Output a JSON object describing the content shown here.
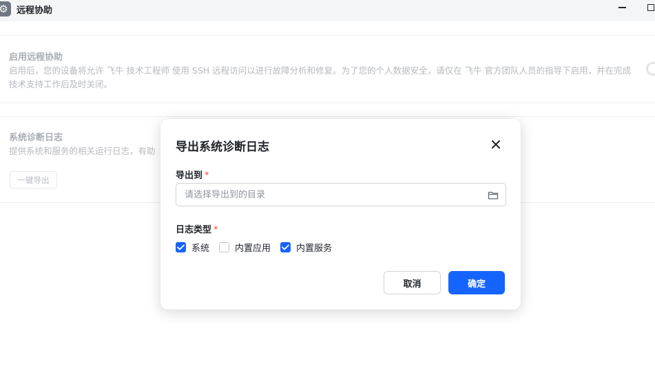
{
  "window": {
    "title": "远程协助",
    "icon": "gear-icon"
  },
  "settings": {
    "remote_assist": {
      "title": "启用远程协助",
      "description": "启用后，您的设备将允许 飞牛 技术工程师 使用 SSH 远程访问以进行故障分析和修复。为了您的个人数据安全，请仅在 飞牛 官方团队人员的指导下启用，并在完成技术支持工作后及时关闭。",
      "enabled": false
    },
    "diagnostics": {
      "title": "系统诊断日志",
      "description": "提供系统和服务的相关运行日志，有助",
      "export_button": "一键导出"
    }
  },
  "dialog": {
    "title": "导出系统诊断日志",
    "close_icon": "close-icon",
    "export_to_label": "导出到",
    "required_mark": "*",
    "path_placeholder": "请选择导出到的目录",
    "path_value": "",
    "folder_icon": "folder-icon",
    "log_type_label": "日志类型",
    "log_types": [
      {
        "label": "系统",
        "checked": true
      },
      {
        "label": "内置应用",
        "checked": false
      },
      {
        "label": "内置服务",
        "checked": true
      }
    ],
    "cancel_label": "取消",
    "confirm_label": "确定"
  },
  "colors": {
    "accent": "#1664ff",
    "required": "#f54a45"
  }
}
